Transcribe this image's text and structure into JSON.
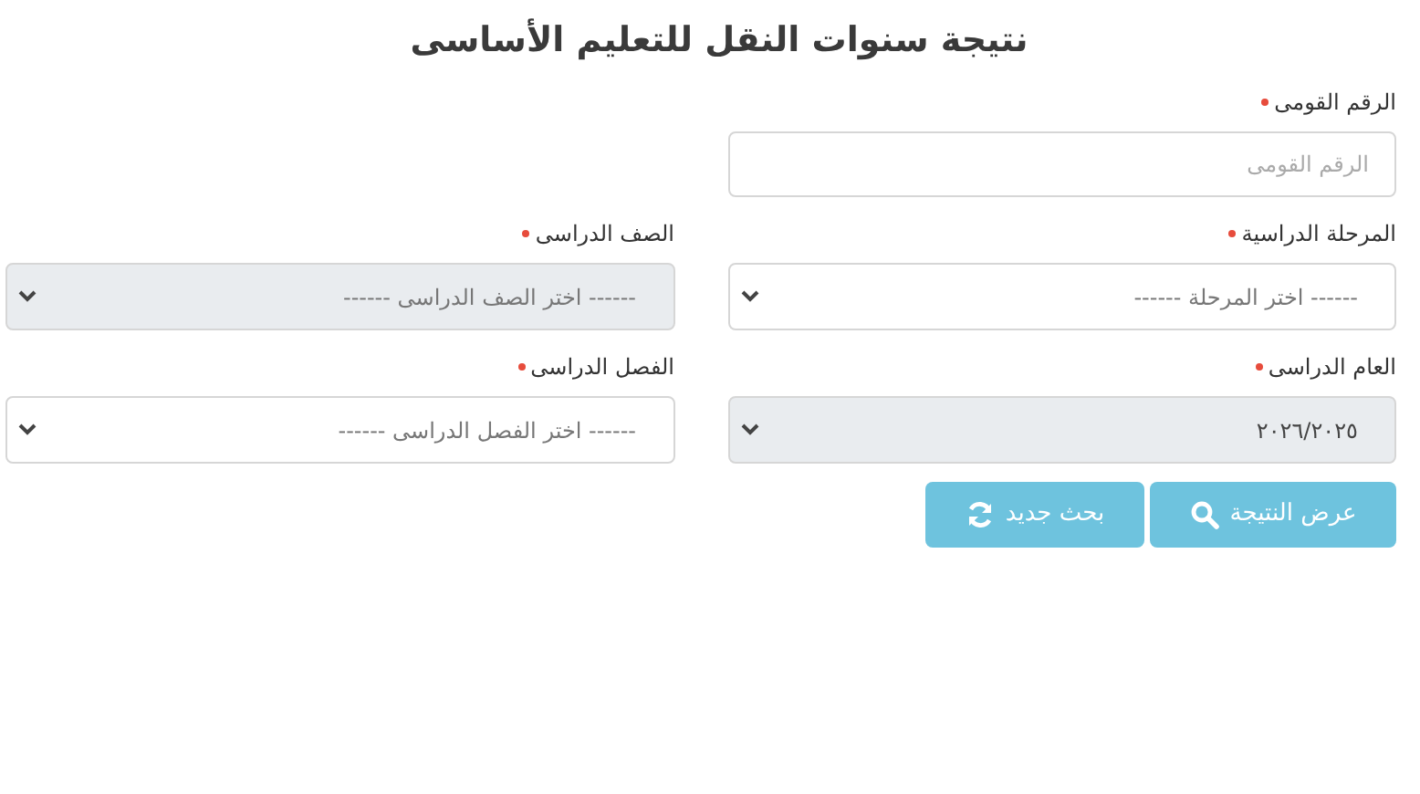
{
  "title": "نتيجة سنوات النقل للتعليم الأساسى",
  "rows": [
    [
      {
        "kind": "text",
        "label": "الرقم القومى",
        "required": true,
        "placeholder": "الرقم القومى",
        "disabled": false
      }
    ],
    [
      {
        "kind": "select",
        "label": "المرحلة الدراسية",
        "required": true,
        "placeholder": "------ اختر المرحلة ------",
        "disabled": false
      },
      {
        "kind": "select",
        "label": "الصف الدراسى",
        "required": true,
        "placeholder": "------ اختر الصف الدراسى ------",
        "disabled": true
      }
    ],
    [
      {
        "kind": "select",
        "label": "العام الدراسى",
        "required": true,
        "value": "٢٠٢٦/٢٠٢٥",
        "disabled": true
      },
      {
        "kind": "select",
        "label": "الفصل الدراسى",
        "required": true,
        "placeholder": "------ اختر الفصل الدراسى ------",
        "disabled": false
      }
    ]
  ],
  "buttons": [
    {
      "label": "عرض النتيجة",
      "kind": "submit"
    },
    {
      "label": "بحث جديد",
      "kind": "reset"
    }
  ]
}
